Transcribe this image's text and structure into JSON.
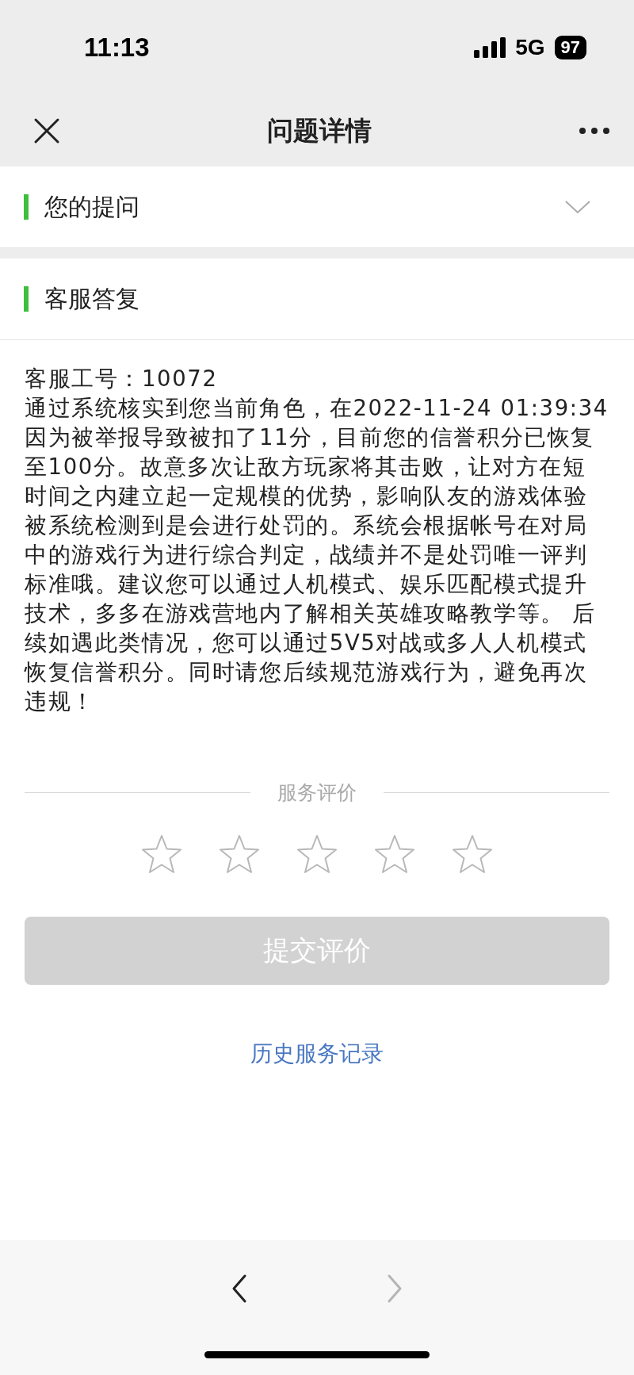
{
  "status_bar": {
    "time": "11:13",
    "network": "5G",
    "battery": "97"
  },
  "nav": {
    "title": "问题详情"
  },
  "sections": [
    {
      "title": "您的提问",
      "expanded": false
    },
    {
      "title": "客服答复"
    }
  ],
  "reply": {
    "staff_id": "客服工号：10072",
    "body": "通过系统核实到您当前角色，在2022-11-24 01:39:34因为被举报导致被扣了11分，目前您的信誉积分已恢复至100分。故意多次让敌方玩家将其击败，让对方在短时间之内建立起一定规模的优势，影响队友的游戏体验被系统检测到是会进行处罚的。系统会根据帐号在对局中的游戏行为进行综合判定，战绩并不是处罚唯一评判标准哦。建议您可以通过人机模式、娱乐匹配模式提升技术，多多在游戏营地内了解相关英雄攻略教学等。 后续如遇此类情况，您可以通过5V5对战或多人人机模式恢复信誉积分。同时请您后续规范游戏行为，避免再次违规！"
  },
  "rating": {
    "label": "服务评价",
    "stars": 0,
    "submit": {
      "label": "提交评价",
      "disabled": true
    }
  },
  "history_link": "历史服务记录",
  "toolbar": {
    "back": {
      "disabled": false
    },
    "forward": {
      "disabled": true
    }
  }
}
